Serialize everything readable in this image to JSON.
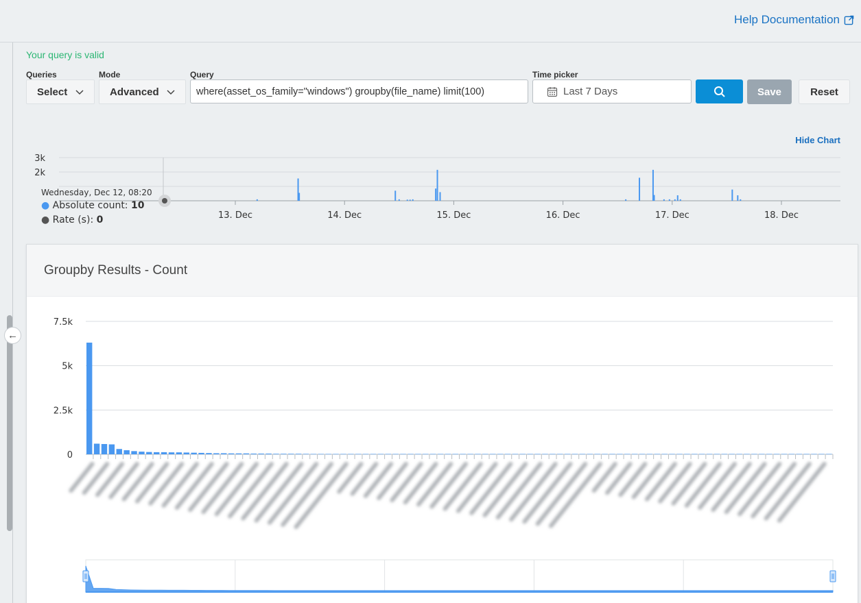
{
  "header": {
    "help_label": "Help Documentation",
    "help_icon": "external-link-icon"
  },
  "query_form": {
    "valid_message": "Your query is valid",
    "queries_label": "Queries",
    "queries_value": "Select",
    "mode_label": "Mode",
    "mode_value": "Advanced",
    "query_label": "Query",
    "query_value": "where(asset_os_family=\"windows\") groupby(file_name) limit(100)",
    "time_label": "Time picker",
    "time_value": "Last 7 Days",
    "search_icon": "search-icon",
    "save_label": "Save",
    "reset_label": "Reset"
  },
  "colors": {
    "accent": "#0b8ed6",
    "bar": "#4a98f0",
    "valid": "#2bb673",
    "link": "#1a73c4"
  },
  "timeline": {
    "hide_label": "Hide Chart",
    "tooltip": {
      "date": "Wednesday, Dec 12, 08:20",
      "count_label": "Absolute count:",
      "count_value": "10",
      "rate_label": "Rate (s):",
      "rate_value": "0"
    }
  },
  "groupby": {
    "title": "Groupby Results - Count"
  },
  "chart_data": [
    {
      "type": "bar",
      "name": "timeline",
      "x_ticks": [
        "13. Dec",
        "14. Dec",
        "15. Dec",
        "16. Dec",
        "17. Dec",
        "18. Dec"
      ],
      "y_ticks": [
        "3k",
        "2k"
      ],
      "ylim": [
        0,
        3000
      ],
      "grid": true,
      "x": [
        0.4,
        1.15,
        1.17,
        2.93,
        3.0,
        3.15,
        3.2,
        3.25,
        3.67,
        3.7,
        3.75,
        7.15,
        7.4,
        7.65,
        7.67,
        7.85,
        7.95,
        8.05,
        8.1,
        8.15,
        9.1,
        9.2,
        9.25
      ],
      "values": [
        100,
        1550,
        550,
        700,
        100,
        80,
        80,
        100,
        850,
        2150,
        600,
        100,
        1600,
        2150,
        400,
        100,
        100,
        100,
        380,
        100,
        780,
        380,
        100
      ]
    },
    {
      "type": "bar",
      "name": "groupby",
      "y_ticks": [
        "7.5k",
        "5k",
        "2.5k",
        "0"
      ],
      "ylim": [
        0,
        7500
      ],
      "grid": true,
      "values": [
        6300,
        600,
        580,
        560,
        300,
        230,
        180,
        150,
        130,
        120,
        120,
        110,
        110,
        100,
        90,
        80,
        70,
        60,
        60,
        50,
        50,
        50,
        40,
        40,
        40,
        30,
        30,
        30,
        30,
        25,
        20,
        20,
        20,
        20,
        20,
        20,
        20,
        20,
        20,
        20,
        20,
        20,
        20,
        20,
        20,
        20,
        20,
        20,
        20,
        20,
        20,
        20,
        20,
        20,
        20,
        20,
        20,
        20,
        20,
        20,
        20,
        20,
        20,
        20,
        20,
        20,
        20,
        20,
        20,
        20,
        20,
        20,
        20,
        20,
        20,
        20,
        20,
        20,
        20,
        20,
        20,
        20,
        20,
        20,
        20,
        20,
        20,
        20,
        20,
        20,
        20,
        20,
        20,
        20,
        20,
        20,
        20,
        20,
        20,
        20
      ]
    }
  ]
}
